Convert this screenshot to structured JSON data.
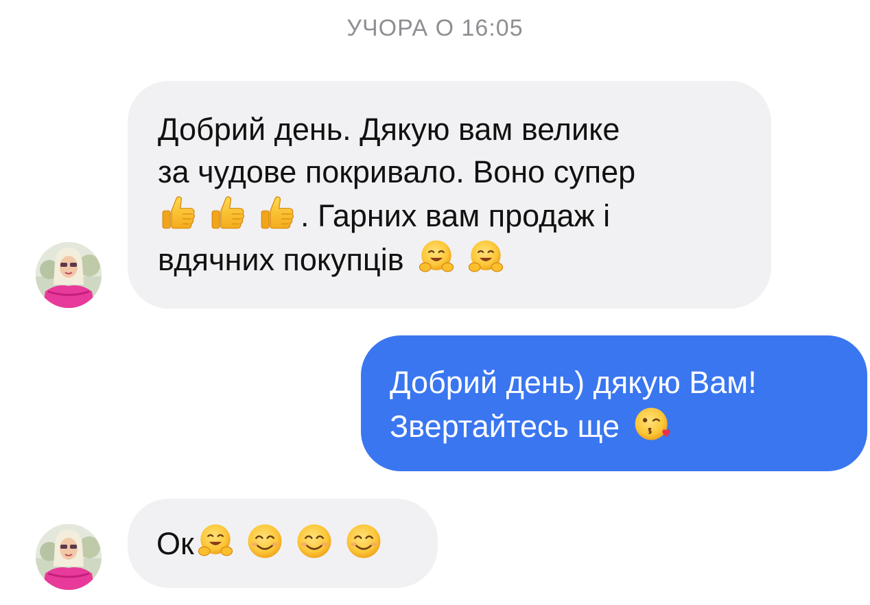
{
  "conversation": {
    "timestamp": "УЧОРА О 16:05",
    "messages": [
      {
        "direction": "incoming",
        "lines": [
          "Добрий день. Дякую вам велике",
          "за чудове покривало. Воно супер",
          ". Гарних вам продаж і",
          "вдячних покупців"
        ],
        "emojis": [
          "thumbs-up-icon",
          "thumbs-up-icon",
          "thumbs-up-icon",
          "hugging-face-icon",
          "hugging-face-icon"
        ]
      },
      {
        "direction": "outgoing",
        "lines": [
          "Добрий день) дякую Вам!",
          "Звертайтесь ще"
        ],
        "emojis": [
          "kissing-face-icon"
        ]
      },
      {
        "direction": "incoming",
        "lines": [
          "Ок"
        ],
        "emojis": [
          "hugging-face-icon",
          "smiling-face-icon",
          "smiling-face-icon",
          "smiling-face-icon"
        ]
      }
    ]
  },
  "colors": {
    "incoming_bubble": "#f1f1f3",
    "outgoing_bubble": "#3a76f0",
    "timestamp_text": "#8e8e93"
  }
}
